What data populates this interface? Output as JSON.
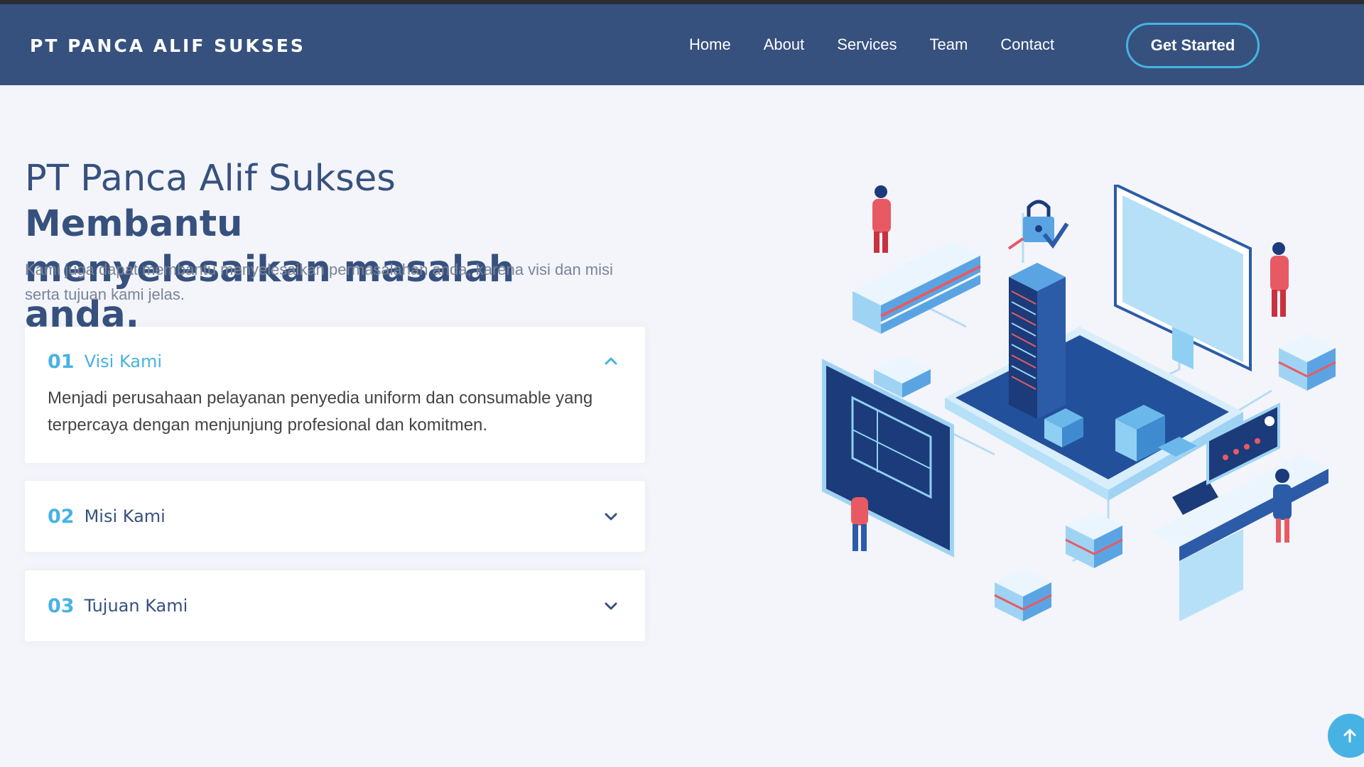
{
  "header": {
    "logo": "PT PANCA ALIF SUKSES",
    "nav": [
      "Home",
      "About",
      "Services",
      "Team",
      "Contact"
    ],
    "cta": "Get Started"
  },
  "hero": {
    "title_light": "PT Panca Alif Sukses ",
    "title_bold_1": "Membantu",
    "title_bold_2": "menyelesaikan masalah anda.",
    "subtitle": "Kami juga dapat membantu menyelesaikan permasalahan anda, karena visi dan misi serta tujuan kami jelas."
  },
  "faq": [
    {
      "num": "01",
      "label": "Visi Kami",
      "expanded": true,
      "body": "Menjadi perusahaan pelayanan penyedia uniform dan consumable yang terpercaya dengan menjunjung profesional dan komitmen."
    },
    {
      "num": "02",
      "label": "Misi Kami",
      "expanded": false
    },
    {
      "num": "03",
      "label": "Tujuan Kami",
      "expanded": false
    }
  ],
  "icons": {
    "chevron_up": "chevron-up-icon",
    "chevron_down": "chevron-down-icon",
    "scroll_top": "arrow-up-icon"
  },
  "colors": {
    "header_bg": "#37517e",
    "accent": "#47b2e4",
    "page_bg": "#f3f5fa",
    "title": "#37517e"
  }
}
